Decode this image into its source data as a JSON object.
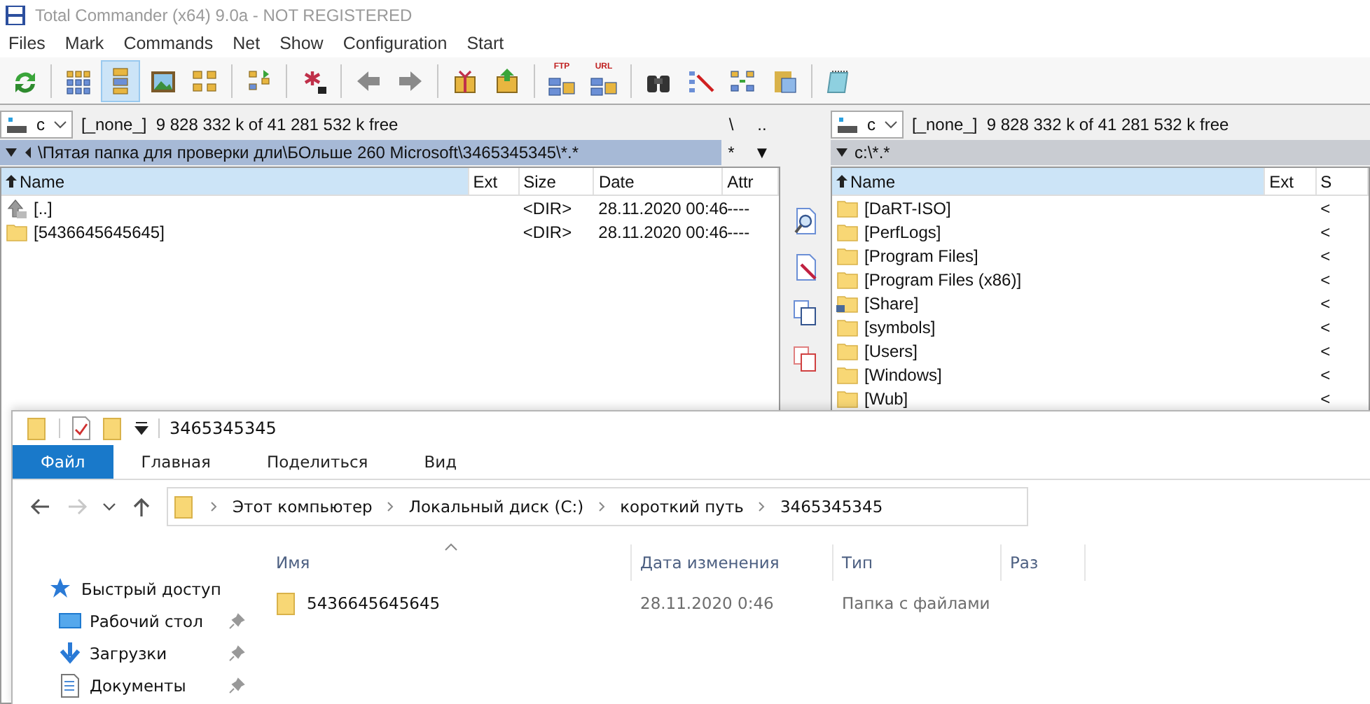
{
  "commander": {
    "title": "Total Commander (x64) 9.0a - NOT REGISTERED",
    "menu": [
      "Files",
      "Mark",
      "Commands",
      "Net",
      "Show",
      "Configuration",
      "Start"
    ],
    "toolbar": [
      {
        "kind": "button",
        "selected": false
      },
      {
        "kind": "separator"
      },
      {
        "kind": "button",
        "selected": false
      },
      {
        "kind": "button",
        "selected": true
      },
      {
        "kind": "button",
        "selected": false
      },
      {
        "kind": "button",
        "selected": false
      },
      {
        "kind": "separator"
      },
      {
        "kind": "button",
        "selected": false
      },
      {
        "kind": "separator"
      },
      {
        "kind": "button",
        "selected": false
      },
      {
        "kind": "separator"
      },
      {
        "kind": "button",
        "selected": false
      },
      {
        "kind": "button",
        "selected": false
      },
      {
        "kind": "separator"
      },
      {
        "kind": "button",
        "selected": false
      },
      {
        "kind": "button",
        "selected": false
      },
      {
        "kind": "separator"
      },
      {
        "kind": "button",
        "selected": false,
        "label": "FTP"
      },
      {
        "kind": "button",
        "selected": false,
        "label": "URL"
      },
      {
        "kind": "separator"
      },
      {
        "kind": "button",
        "selected": false
      },
      {
        "kind": "button",
        "selected": false
      },
      {
        "kind": "button",
        "selected": false
      },
      {
        "kind": "button",
        "selected": false
      },
      {
        "kind": "separator"
      },
      {
        "kind": "button",
        "selected": false
      }
    ],
    "left_panel": {
      "active": true,
      "drive": "c",
      "free": "[_none_]  9 828 332 k of 41 281 532 k free",
      "nav_buttons": [
        "\\",
        ".."
      ],
      "path": "\\Пятая папка для проверки дли\\БОльше 260 Microsoft\\3465345345\\*.*",
      "filter_buttons": [
        "*",
        "▼"
      ],
      "columns": [
        "Name",
        "Ext",
        "Size",
        "Date",
        "Attr"
      ],
      "rows": [
        {
          "kind": "up",
          "cells": [
            "[..]",
            "",
            "<DIR>",
            "28.11.2020 00:46",
            "----"
          ]
        },
        {
          "kind": "folder",
          "cells": [
            "[5436645645645]",
            "",
            "<DIR>",
            "28.11.2020 00:46",
            "----"
          ]
        }
      ]
    },
    "right_panel": {
      "active": false,
      "drive": "c",
      "free": "[_none_]  9 828 332 k of 41 281 532 k free",
      "path": "c:\\*.*",
      "columns": [
        "Name",
        "Ext",
        "S"
      ],
      "rows": [
        {
          "kind": "folder",
          "cells": [
            "[DaRT-ISO]",
            "",
            "<"
          ]
        },
        {
          "kind": "folder",
          "cells": [
            "[PerfLogs]",
            "",
            "<"
          ]
        },
        {
          "kind": "folder",
          "cells": [
            "[Program Files]",
            "",
            "<"
          ]
        },
        {
          "kind": "folder",
          "cells": [
            "[Program Files (x86)]",
            "",
            "<"
          ]
        },
        {
          "kind": "share",
          "cells": [
            "[Share]",
            "",
            "<"
          ]
        },
        {
          "kind": "folder",
          "cells": [
            "[symbols]",
            "",
            "<"
          ]
        },
        {
          "kind": "folder",
          "cells": [
            "[Users]",
            "",
            "<"
          ]
        },
        {
          "kind": "folder",
          "cells": [
            "[Windows]",
            "",
            "<"
          ]
        },
        {
          "kind": "folder",
          "cells": [
            "[Wub]",
            "",
            "<"
          ]
        }
      ]
    }
  },
  "explorer": {
    "title": "3465345345",
    "tabs": [
      {
        "label": "Файл",
        "selected": true
      },
      {
        "label": "Главная",
        "selected": false
      },
      {
        "label": "Поделиться",
        "selected": false
      },
      {
        "label": "Вид",
        "selected": false
      }
    ],
    "nav_buttons": [
      {
        "kind": "back",
        "disabled": false
      },
      {
        "kind": "forward",
        "disabled": true
      },
      {
        "kind": "recent",
        "disabled": false
      },
      {
        "kind": "up",
        "disabled": false
      }
    ],
    "breadcrumbs": [
      "Этот компьютер",
      "Локальный диск (C:)",
      "короткий путь",
      "3465345345"
    ],
    "nav_pane": [
      {
        "kind": "quick",
        "label": "Быстрый доступ",
        "pinned": false
      },
      {
        "kind": "desktop",
        "label": "Рабочий стол",
        "pinned": true
      },
      {
        "kind": "downloads",
        "label": "Загрузки",
        "pinned": true
      },
      {
        "kind": "documents",
        "label": "Документы",
        "pinned": true
      }
    ],
    "columns": [
      "Имя",
      "Дата изменения",
      "Тип",
      "Раз"
    ],
    "rows": [
      {
        "name": "5436645645645",
        "date": "28.11.2020 0:46",
        "type": "Папка с файлами"
      }
    ]
  }
}
